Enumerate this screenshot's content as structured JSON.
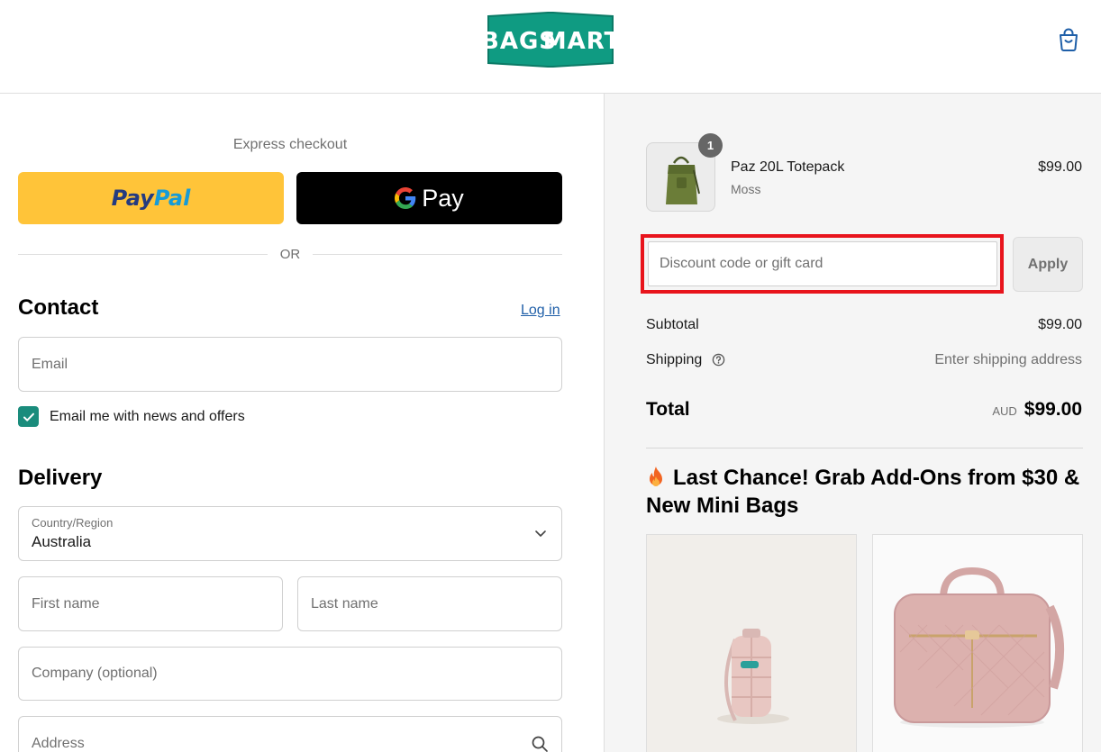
{
  "brand": {
    "logo_text_1": "BAGS",
    "logo_text_2": "MART",
    "color": "#0f9b82"
  },
  "header": {
    "cart_icon": "shopping-bag-icon"
  },
  "express": {
    "title": "Express checkout",
    "paypal_part1": "Pay",
    "paypal_part2": "Pal",
    "gpay_label": "Pay",
    "or_text": "OR"
  },
  "contact": {
    "title": "Contact",
    "login_label": "Log in",
    "email_placeholder": "Email",
    "newsletter_label": "Email me with news and offers",
    "newsletter_checked": true
  },
  "delivery": {
    "title": "Delivery",
    "country_label": "Country/Region",
    "country_value": "Australia",
    "first_name_placeholder": "First name",
    "last_name_placeholder": "Last name",
    "company_placeholder": "Company (optional)",
    "address_placeholder": "Address"
  },
  "order": {
    "items": [
      {
        "name": "Paz 20L Totepack",
        "variant": "Moss",
        "price": "$99.00",
        "quantity": "1"
      }
    ],
    "discount_placeholder": "Discount code or gift card",
    "apply_label": "Apply",
    "subtotal_label": "Subtotal",
    "subtotal_value": "$99.00",
    "shipping_label": "Shipping",
    "shipping_value": "Enter shipping address",
    "total_label": "Total",
    "currency": "AUD",
    "total_value": "$99.00"
  },
  "promo": {
    "title": "Last Chance! Grab Add-Ons from $30 & New Mini Bags"
  },
  "colors": {
    "accent_checkbox": "#1a8c7c",
    "link": "#1f5fa8",
    "paypal_bg": "#ffc439",
    "highlight": "#e8141c"
  }
}
